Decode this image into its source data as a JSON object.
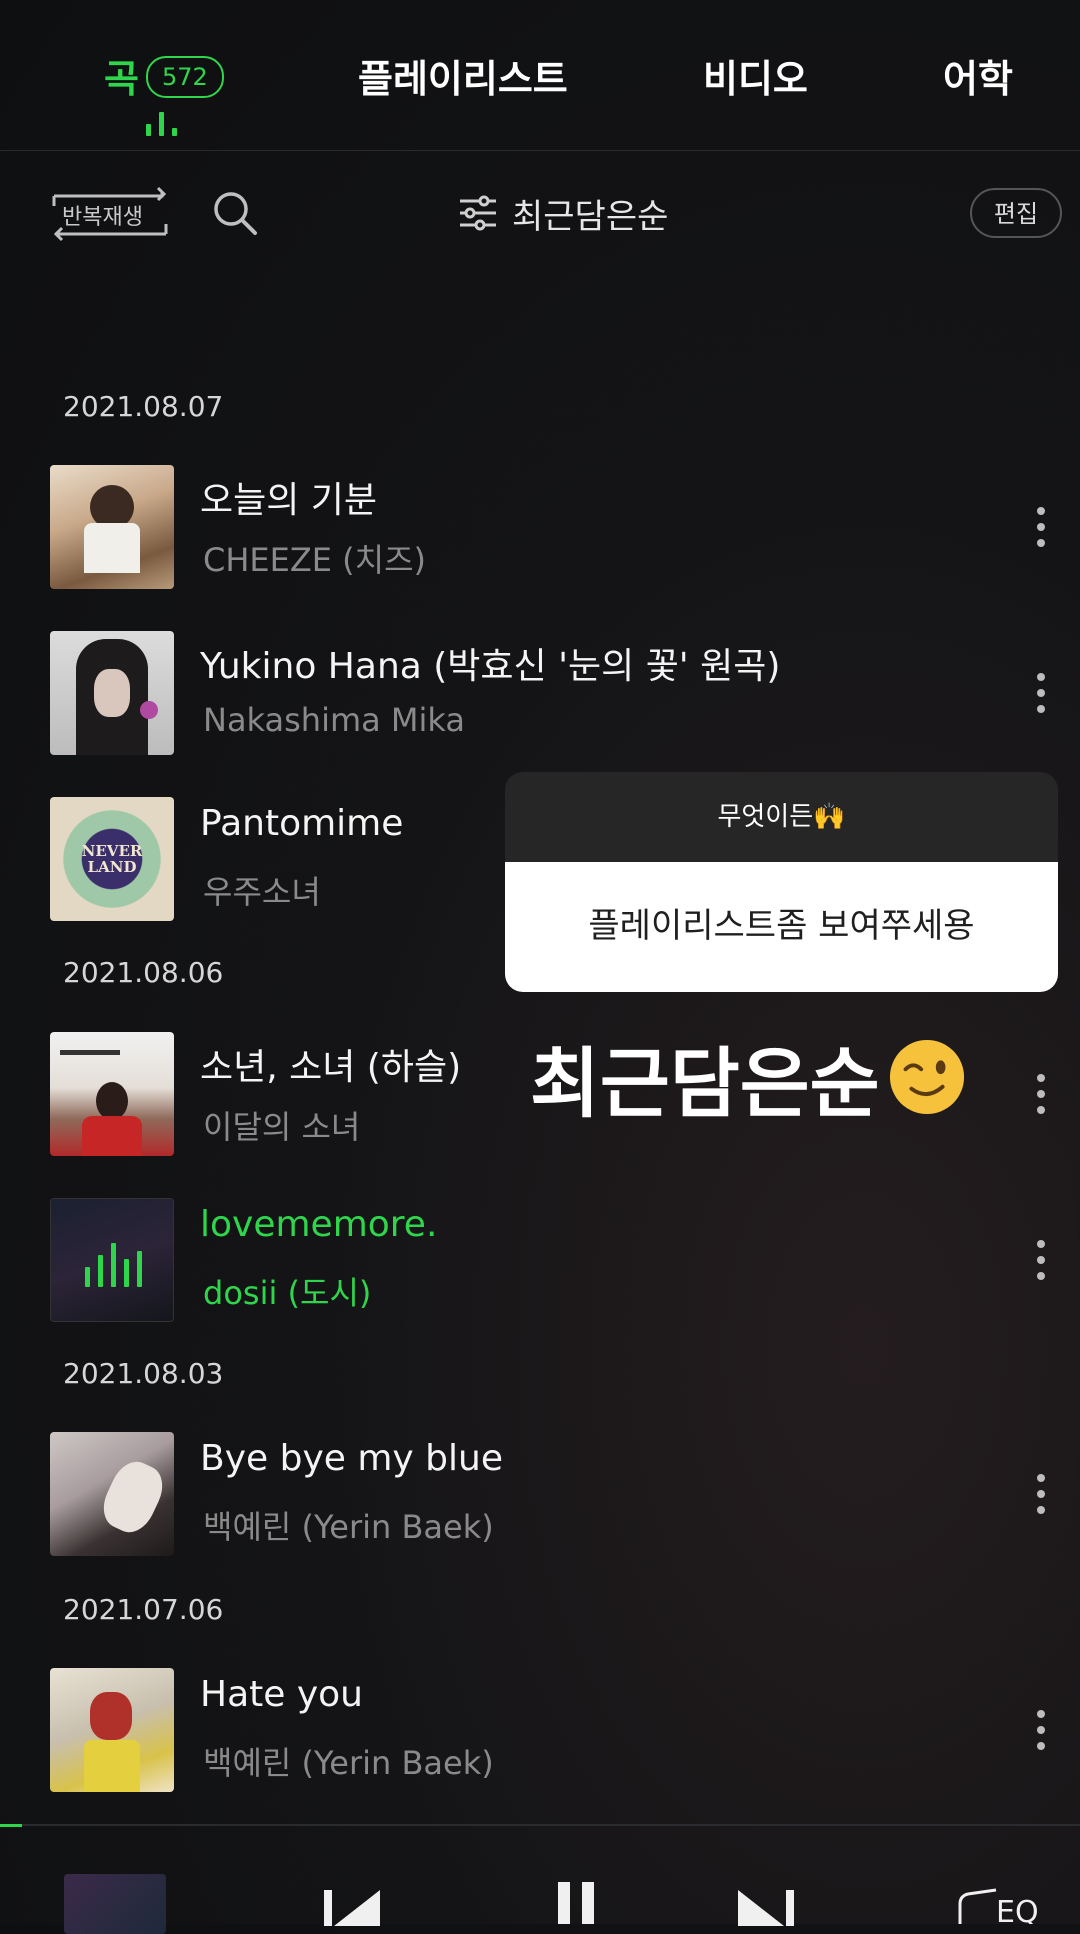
{
  "tabs": [
    {
      "label": "곡",
      "count": "572",
      "active": true
    },
    {
      "label": "플레이리스트"
    },
    {
      "label": "비디오"
    },
    {
      "label": "어학"
    }
  ],
  "toolbar": {
    "repeat_label": "반복재생",
    "sort_label": "최근담은순",
    "edit_label": "편집"
  },
  "groups": [
    {
      "date": "2021.08.07",
      "songs": [
        {
          "title": "오늘의 기분",
          "artist": "CHEEZE (치즈)"
        },
        {
          "title": "Yukino Hana (박효신 '눈의 꽃' 원곡)",
          "artist": "Nakashima Mika"
        },
        {
          "title": "Pantomime",
          "artist": "우주소녀"
        }
      ]
    },
    {
      "date": "2021.08.06",
      "songs": [
        {
          "title": "소년, 소녀 (하슬)",
          "artist": "이달의 소녀"
        },
        {
          "title": "lovememore.",
          "artist": "dosii (도시)",
          "playing": true
        }
      ]
    },
    {
      "date": "2021.08.03",
      "songs": [
        {
          "title": "Bye bye my blue",
          "artist": "백예린 (Yerin Baek)"
        }
      ]
    },
    {
      "date": "2021.07.06",
      "songs": [
        {
          "title": "Hate you",
          "artist": "백예린 (Yerin Baek)"
        }
      ]
    }
  ],
  "sticker": {
    "question": "무엇이든🙌",
    "answer": "플레이리스트좀 보여쭈세용"
  },
  "overlay_text": "최근담은순",
  "player": {
    "progress": 0.02
  },
  "colors": {
    "accent": "#2fd64b",
    "background": "#141416"
  }
}
